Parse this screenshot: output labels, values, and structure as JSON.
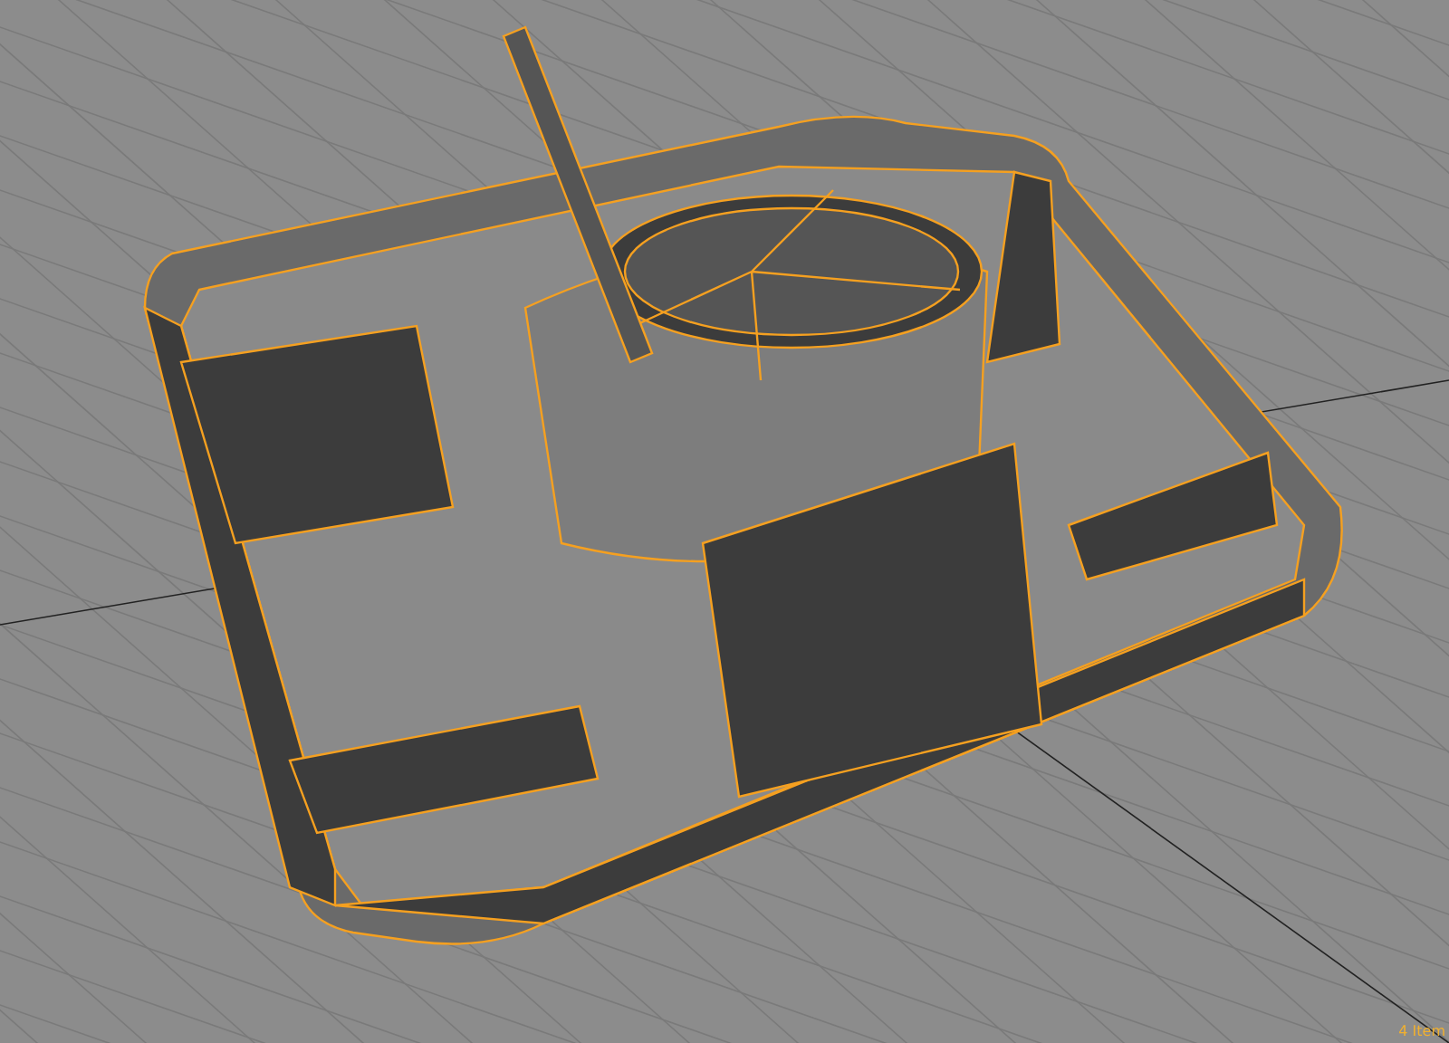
{
  "viewport": {
    "status": {
      "selection_count": "4 Item"
    }
  }
}
